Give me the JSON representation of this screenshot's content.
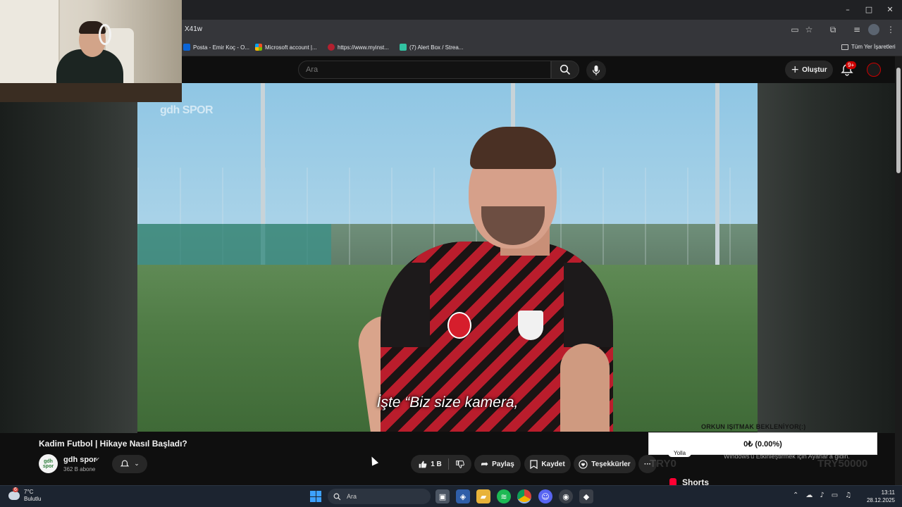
{
  "browser": {
    "url": "X41w",
    "window_controls": {
      "minimize": "–",
      "maximize": "□",
      "close": "✕"
    },
    "bookmarks": [
      {
        "label": "Posta - Emir Koç - O...",
        "color": "#0a64d6"
      },
      {
        "label": "Microsoft account |...",
        "color": "#f25022"
      },
      {
        "label": "https://www.myinst...",
        "color": "#b3202f"
      },
      {
        "label": "(7) Alert Box / Strea...",
        "color": "#31c3a2"
      }
    ],
    "all_bookmarks": "Tüm Yer İşaretleri"
  },
  "yt": {
    "search_placeholder": "Ara",
    "create_label": "Oluştur",
    "notif_count": "9+"
  },
  "video": {
    "channel_watermark": "gdh SPOR",
    "subtitle": "İşte “Biz size kamera,",
    "title": "Kadim Futbol | Hikaye Nasıl Başladı?",
    "channel_name": "gdh spor",
    "channel_avatar_text": "gdh spor",
    "subscribers": "362 B abone",
    "likes": "1 B",
    "share_label": "Paylaş",
    "save_label": "Kaydet",
    "thanks_label": "Teşekkürler",
    "more_label": "···"
  },
  "stream_overlay": {
    "alert_title": "ORKUN IŞITMAK BEKLENİYOR(:)",
    "donation_progress": "0₺ (0.00%)",
    "tag": "Yolla",
    "windows_activate": "Windows'u Etkinleştirmek için Ayarlar'a gidin.",
    "goal_left": "TRY0",
    "goal_right": "TRY50000"
  },
  "sidebar": {
    "shorts_label": "Shorts"
  },
  "taskbar": {
    "temperature": "7°C",
    "weather": "Bulutlu",
    "weather_badge": "6",
    "search_placeholder": "Ara",
    "time": "13:11",
    "date": "28.12.2025"
  },
  "colors": {
    "accent_red": "#cc0000",
    "youtube_bg": "#0f0f0f",
    "pill_bg": "#272727"
  }
}
